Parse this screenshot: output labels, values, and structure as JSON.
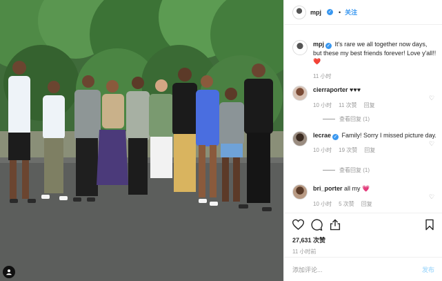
{
  "post": {
    "username": "mpj",
    "header_dot": "•",
    "follow_label": "关注",
    "verified_mark": "✓",
    "caption_user": "mpj",
    "caption_text": "It's rare we all together now days, but these my best friends forever! Love y'all!! ",
    "caption_heart": "❤️",
    "caption_time": "11 小时",
    "likes": "27,631 次赞",
    "time_ago": "11 小时前",
    "comment_placeholder": "添加评论...",
    "post_button": "发布"
  },
  "comments": [
    {
      "user": "cierraporter",
      "verified": false,
      "text": "♥♥♥",
      "time": "10 小时",
      "likes": "11 次赞",
      "reply": "回复",
      "replies": "查看回复 (1)"
    },
    {
      "user": "lecrae",
      "verified": true,
      "text": "Family! Sorry I missed picture day.",
      "time": "10 小时",
      "likes": "19 次赞",
      "reply": "回复",
      "replies": "查看回复 (1)"
    },
    {
      "user": "bri_porter",
      "verified": false,
      "text": "all my ",
      "text_emoji": "💗",
      "time": "10 小时",
      "likes": "5 次赞",
      "reply": "回复"
    }
  ],
  "icons": {
    "like": "heart-outline-icon",
    "comment": "comment-bubble-icon",
    "share": "share-upload-icon",
    "save": "bookmark-icon",
    "comment_like": "small-heart-icon"
  },
  "colors": {
    "link": "#3897f0",
    "muted": "#999999",
    "post_disabled": "#b2dffc",
    "heart": "#ed4956"
  }
}
